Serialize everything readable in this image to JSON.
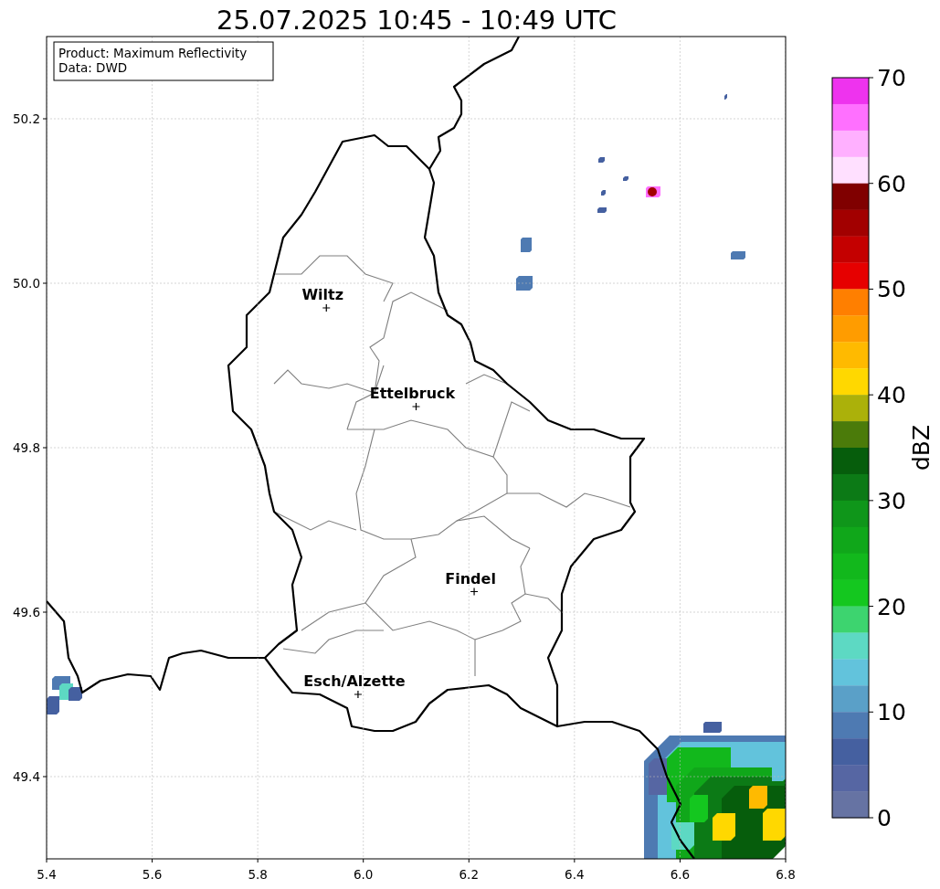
{
  "figure": {
    "info_box": [
      "Product: Maximum Reflectivity",
      "Data: DWD"
    ],
    "chart_data": {
      "type": "scatter",
      "title": "25.07.2025 10:45 - 10:49 UTC",
      "grid": true,
      "x": [
        5.93,
        6.1,
        6.21,
        5.99
      ],
      "series": [
        {
          "color": "#000000",
          "values": [
            49.97,
            49.85,
            49.625,
            49.5
          ]
        }
      ],
      "xlim": [
        5.4,
        6.8
      ],
      "ylim": [
        49.3,
        50.3
      ],
      "xticks": [
        {
          "value": 5.4,
          "label": "5.4"
        },
        {
          "value": 5.6,
          "label": "5.6"
        },
        {
          "value": 5.8,
          "label": "5.8"
        },
        {
          "value": 6.0,
          "label": "6.0"
        },
        {
          "value": 6.2,
          "label": "6.2"
        },
        {
          "value": 6.4,
          "label": "6.4"
        },
        {
          "value": 6.6,
          "label": "6.6"
        },
        {
          "value": 6.8,
          "label": "6.8"
        }
      ],
      "yticks": [
        {
          "value": 50.2,
          "label": "50.2"
        },
        {
          "value": 50.0,
          "label": "50.0"
        },
        {
          "value": 49.8,
          "label": "49.8"
        },
        {
          "value": 49.6,
          "label": "49.6"
        },
        {
          "value": 49.4,
          "label": "49.4"
        }
      ],
      "annotations": [
        {
          "text": "Wiltz",
          "x": 5.93,
          "y": 49.97
        },
        {
          "text": "Ettelbruck",
          "x": 6.1,
          "y": 49.85
        },
        {
          "text": "Findel",
          "x": 6.21,
          "y": 49.625
        },
        {
          "text": "Esch/Alzette",
          "x": 5.99,
          "y": 49.5
        }
      ]
    },
    "colorbar": {
      "label": "dBZ",
      "ticks": [
        "70",
        "60",
        "50",
        "40",
        "30",
        "20",
        "10",
        "0"
      ],
      "segments": [
        {
          "color": "#ee33ee"
        },
        {
          "color": "#ff70ff"
        },
        {
          "color": "#ffb0ff"
        },
        {
          "color": "#ffe0ff"
        },
        {
          "color": "#800000"
        },
        {
          "color": "#a20000"
        },
        {
          "color": "#c40000"
        },
        {
          "color": "#e60000"
        },
        {
          "color": "#ff7f00"
        },
        {
          "color": "#ff9c00"
        },
        {
          "color": "#ffba00"
        },
        {
          "color": "#ffd800"
        },
        {
          "color": "#abb10a"
        },
        {
          "color": "#4b7b0a"
        },
        {
          "color": "#065d0c"
        },
        {
          "color": "#0c7a16"
        },
        {
          "color": "#0f961a"
        },
        {
          "color": "#10a71a"
        },
        {
          "color": "#12b81c"
        },
        {
          "color": "#14c71f"
        },
        {
          "color": "#3dd46f"
        },
        {
          "color": "#5dd9c3"
        },
        {
          "color": "#62c3dc"
        },
        {
          "color": "#5aa0c8"
        },
        {
          "color": "#4e7ab2"
        },
        {
          "color": "#4560a0"
        },
        {
          "color": "#5666a3"
        },
        {
          "color": "#6673a3"
        }
      ]
    }
  }
}
